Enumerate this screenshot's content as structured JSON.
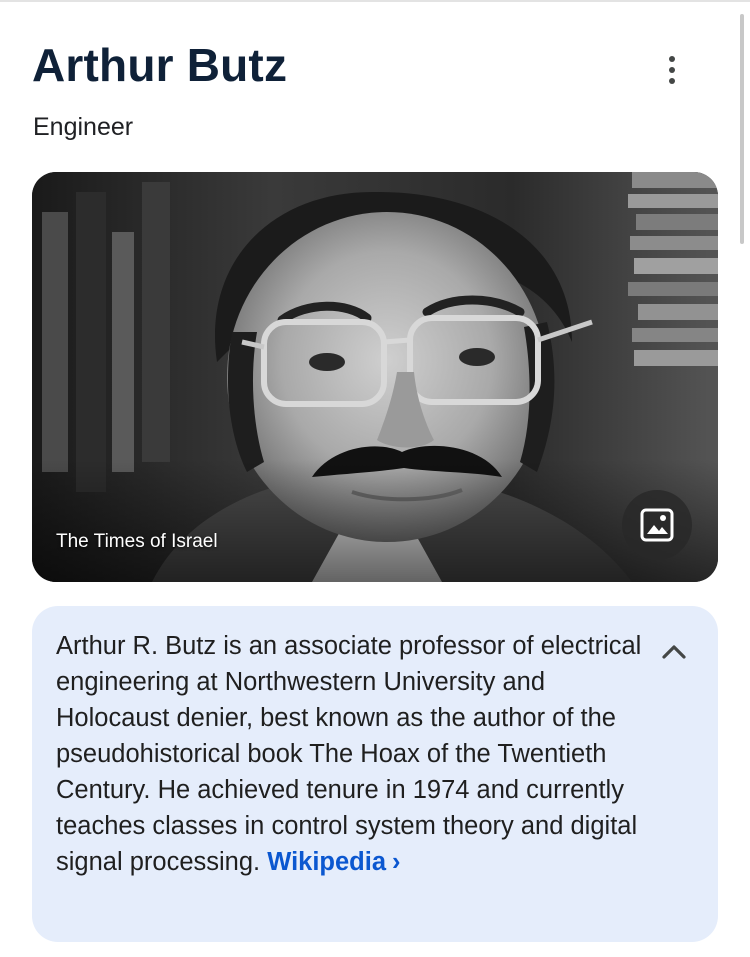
{
  "entity": {
    "title": "Arthur Butz",
    "subtitle": "Engineer"
  },
  "image": {
    "source": "The Times of Israel",
    "button_icon": "image-icon"
  },
  "menu": {
    "icon": "more-vert-icon"
  },
  "description": {
    "text": "Arthur R. Butz is an associate professor of electrical engineering at Northwestern University and Holocaust denier, best known as the author of the pseudohistorical book The Hoax of the Twentieth Century. He achieved tenure in 1974 and currently teaches classes in control system theory and digital signal processing.",
    "source_label": "Wikipedia",
    "source_chevron": "›",
    "collapse_icon": "chevron-up-icon"
  },
  "colors": {
    "title": "#0f2138",
    "link": "#0b57d0",
    "card_background": "#e5edfb"
  }
}
